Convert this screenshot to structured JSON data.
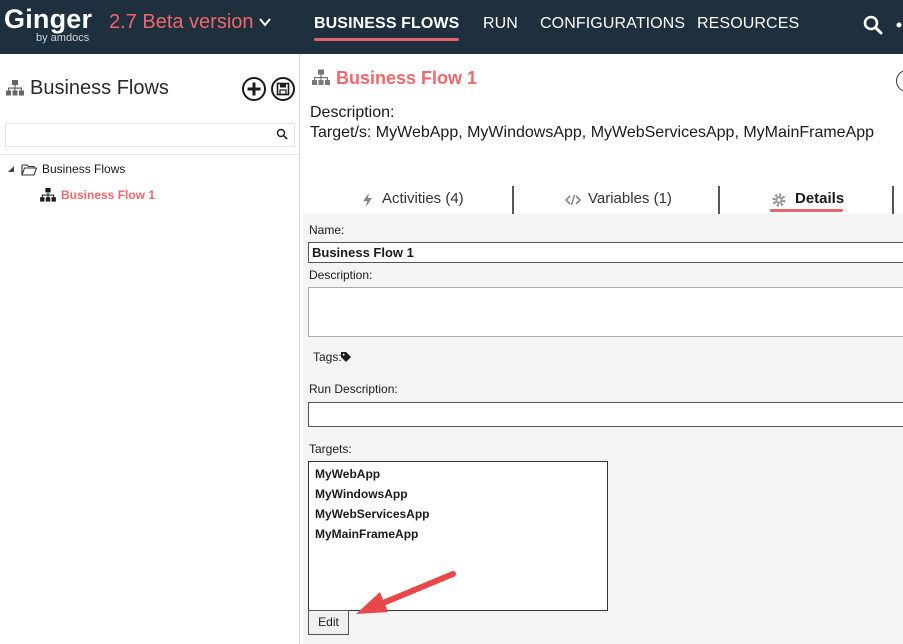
{
  "topbar": {
    "logo_name": "Ginger",
    "logo_by": "by amdocs",
    "version": "2.7 Beta version",
    "nav": [
      "BUSINESS FLOWS",
      "RUN",
      "CONFIGURATIONS",
      "RESOURCES"
    ]
  },
  "left_panel": {
    "title": "Business Flows",
    "search_value": "",
    "tree": {
      "root_label": "Business Flows",
      "child_label": "Business Flow 1"
    }
  },
  "main": {
    "title": "Business Flow 1",
    "description_label": "Description:",
    "targets_line": "Target/s: MyWebApp, MyWindowsApp, MyWebServicesApp, MyMainFrameApp",
    "tabs": [
      {
        "label": "Activities (4)",
        "icon": "lightning-icon"
      },
      {
        "label": "Variables (1)",
        "icon": "code-icon"
      },
      {
        "label": "Details",
        "icon": "gear-icon"
      }
    ],
    "form": {
      "name_label": "Name:",
      "name_value": "Business Flow 1",
      "description_label": "Description:",
      "description_value": "",
      "tags_label": "Tags:",
      "run_description_label": "Run Description:",
      "run_description_value": "",
      "targets_label": "Targets:",
      "targets": [
        "MyWebApp",
        "MyWindowsApp",
        "MyWebServicesApp",
        "MyMainFrameApp"
      ],
      "edit_label": "Edit"
    }
  },
  "colors": {
    "topbar_bg": "#1e2f3d",
    "accent": "#f0686c",
    "annotation_arrow": "#e8484a"
  }
}
